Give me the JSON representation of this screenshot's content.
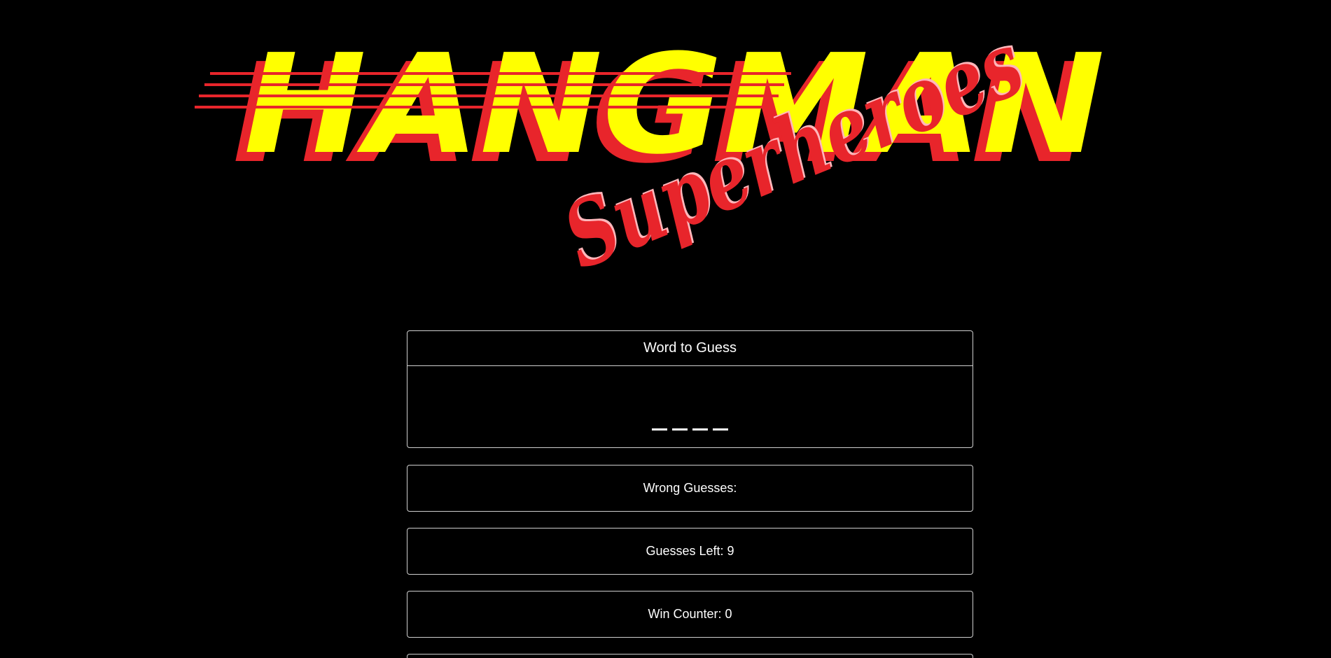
{
  "logo": {
    "title": "HANGMAN",
    "subtitle": "Superheroes"
  },
  "word_card": {
    "header": "Word to Guess",
    "blanks": [
      "_",
      "_",
      "_",
      "_"
    ]
  },
  "wrong_guesses": {
    "label": "Wrong Guesses:"
  },
  "guesses_left": {
    "label": "Guesses Left: 9"
  },
  "win_counter": {
    "label": "Win Counter: 0"
  },
  "colors": {
    "background": "#000000",
    "title_yellow": "#ffff00",
    "title_red": "#e8252b",
    "border": "#cfcfcf",
    "text": "#ffffff"
  }
}
